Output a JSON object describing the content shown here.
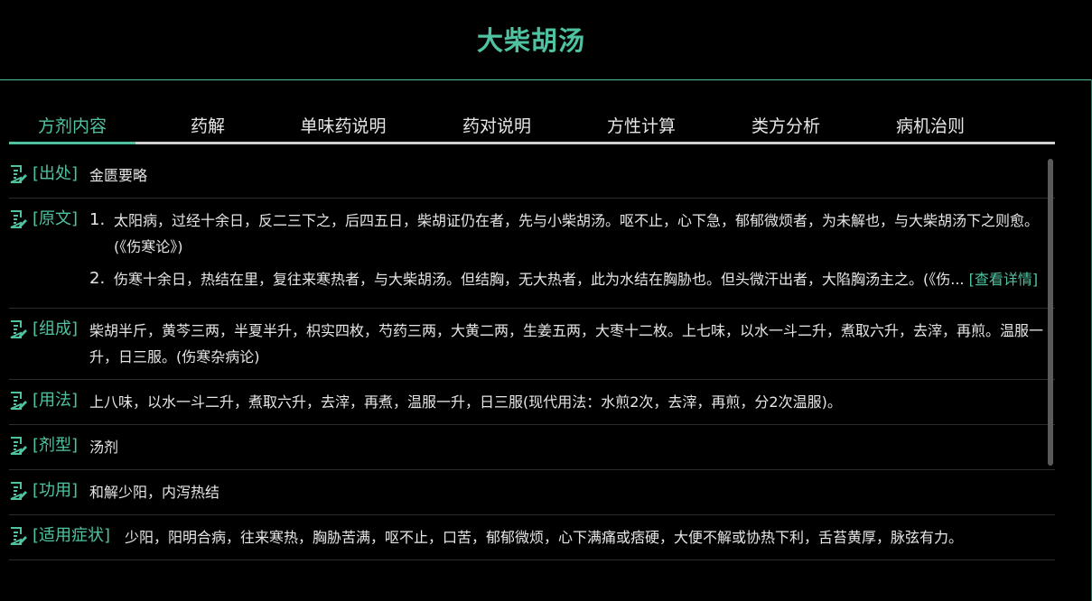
{
  "page": {
    "title": "大柴胡汤"
  },
  "tabs": [
    {
      "label": "方剂内容"
    },
    {
      "label": "药解"
    },
    {
      "label": "单味药说明"
    },
    {
      "label": "药对说明"
    },
    {
      "label": "方性计算"
    },
    {
      "label": "类方分析"
    },
    {
      "label": "病机治则"
    }
  ],
  "sections": {
    "source": {
      "label": "[出处]",
      "text": "金匮要略"
    },
    "original": {
      "label": "[原文]",
      "items": [
        {
          "num": "1.",
          "text": "太阳病，过经十余日，反二三下之，后四五日，柴胡证仍在者，先与小柴胡汤。呕不止，心下急，郁郁微烦者，为未解也，与大柴胡汤下之则愈。(《伤寒论》)"
        },
        {
          "num": "2.",
          "text": "伤寒十余日，热结在里，复往来寒热者，与大柴胡汤。但结胸，无大热者，此为水结在胸胁也。但头微汗出者，大陷胸汤主之。(《伤...",
          "link": "[查看详情]"
        }
      ]
    },
    "composition": {
      "label": "[组成]",
      "text": "柴胡半斤，黄芩三两，半夏半升，枳实四枚，芍药三两，大黄二两，生姜五两，大枣十二枚。上七味，以水一斗二升，煮取六升，去滓，再煎。温服一升，日三服。(伤寒杂病论)"
    },
    "usage": {
      "label": "[用法]",
      "text": "上八味，以水一斗二升，煮取六升，去滓，再煮，温服一升，日三服(现代用法：水煎2次，去滓，再煎，分2次温服)。"
    },
    "form": {
      "label": "[剂型]",
      "text": "汤剂"
    },
    "effect": {
      "label": "[功用]",
      "text": "和解少阳，内泻热结"
    },
    "indications": {
      "label": "[适用症状]",
      "text": "少阳，阳明合病，往来寒热，胸胁苦满，呕不止，口苦，郁郁微烦，心下满痛或痞硬，大便不解或协热下利，舌苔黄厚，脉弦有力。"
    }
  },
  "icons": {
    "section": "document-edit-icon"
  },
  "colors": {
    "accent": "#4fc3a1",
    "background": "#000000",
    "text": "#e6e6e6"
  }
}
